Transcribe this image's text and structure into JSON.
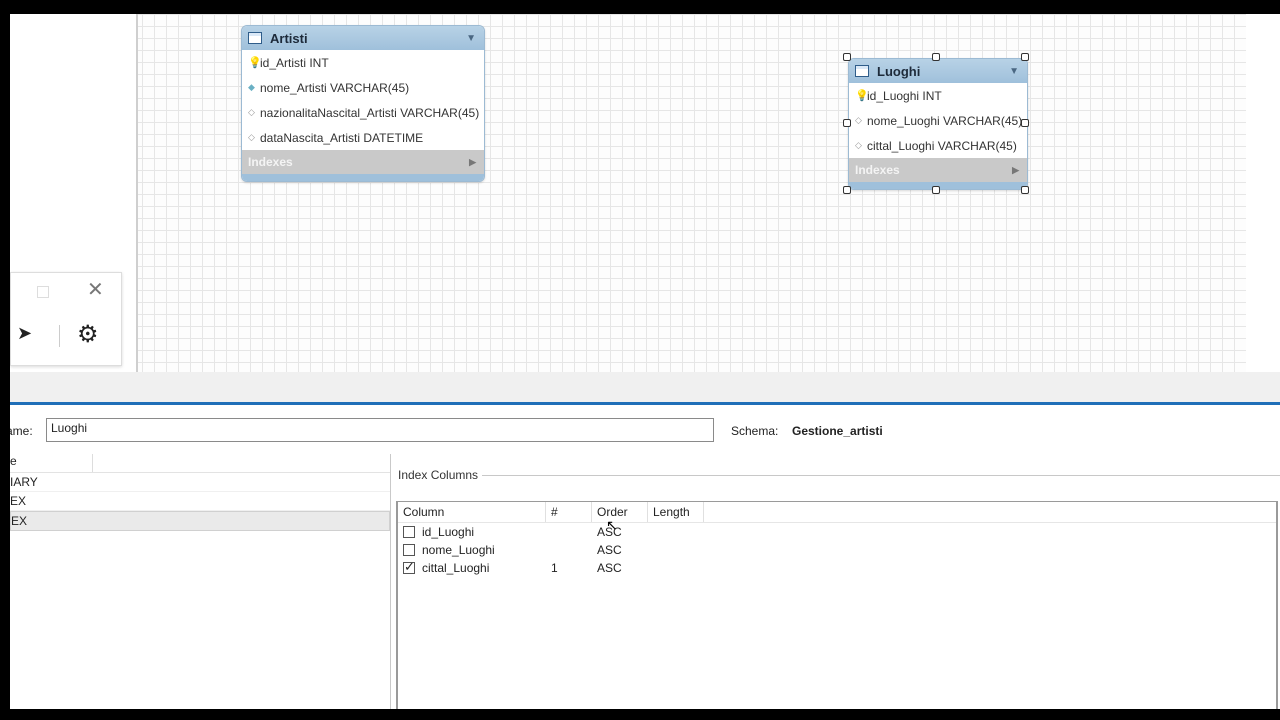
{
  "diagram": {
    "artisti": {
      "title": "Artisti",
      "columns": [
        {
          "text": "id_Artisti INT",
          "kind": "key"
        },
        {
          "text": "nome_Artisti VARCHAR(45)",
          "kind": "filled"
        },
        {
          "text": "nazionalitaNascital_Artisti VARCHAR(45)",
          "kind": "empty"
        },
        {
          "text": "dataNascita_Artisti DATETIME",
          "kind": "empty"
        }
      ],
      "indexes_label": "Indexes"
    },
    "luoghi": {
      "title": "Luoghi",
      "columns": [
        {
          "text": "id_Luoghi INT",
          "kind": "key"
        },
        {
          "text": "nome_Luoghi VARCHAR(45)",
          "kind": "empty"
        },
        {
          "text": "cittal_Luoghi VARCHAR(45)",
          "kind": "empty"
        }
      ],
      "indexes_label": "Indexes"
    }
  },
  "float_panel": {
    "close_glyph": "✕",
    "cursor_glyph": "🔊",
    "gear_glyph": "⚙"
  },
  "editor": {
    "name_label": "ame:",
    "name_value": "Luoghi",
    "schema_label": "Schema:",
    "schema_value": "Gestione_artisti",
    "index_list_header": "e",
    "index_list": [
      "IARY",
      "EX",
      "EX"
    ],
    "index_columns_title": "Index Columns",
    "grid_headers": [
      "Column",
      "#",
      "Order",
      "Length"
    ],
    "grid_rows": [
      {
        "column": "id_Luoghi",
        "checked": false,
        "num": "",
        "order": "ASC",
        "length": ""
      },
      {
        "column": "nome_Luoghi",
        "checked": false,
        "num": "",
        "order": "ASC",
        "length": ""
      },
      {
        "column": "cittal_Luoghi",
        "checked": true,
        "num": "1",
        "order": "ASC",
        "length": ""
      }
    ]
  }
}
